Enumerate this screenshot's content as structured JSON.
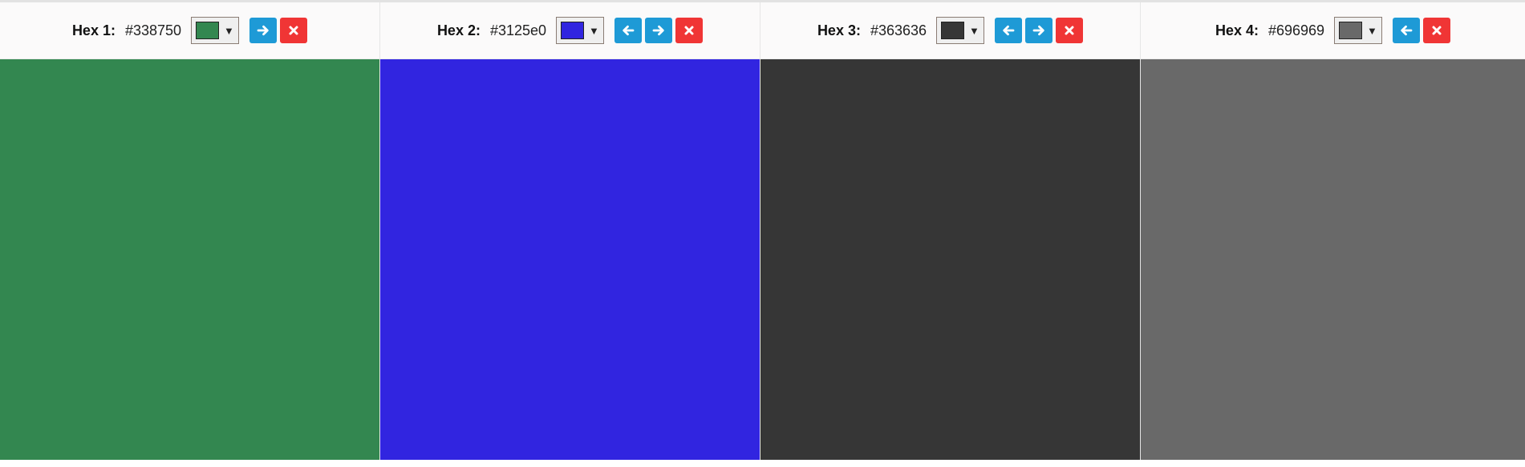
{
  "palette": {
    "colors": [
      {
        "label": "Hex 1:",
        "hex": "#338750",
        "color": "#338750",
        "has_left": false,
        "has_right": true
      },
      {
        "label": "Hex 2:",
        "hex": "#3125e0",
        "color": "#3125e0",
        "has_left": true,
        "has_right": true
      },
      {
        "label": "Hex 3:",
        "hex": "#363636",
        "color": "#363636",
        "has_left": true,
        "has_right": true
      },
      {
        "label": "Hex 4:",
        "hex": "#696969",
        "color": "#696969",
        "has_left": true,
        "has_right": false
      }
    ],
    "icons": {
      "move_left": "arrow-left-icon",
      "move_right": "arrow-right-icon",
      "remove": "close-icon",
      "dropdown": "chevron-down-icon"
    },
    "accent_colors": {
      "move_button": "#1e9ad6",
      "remove_button": "#f03535"
    }
  }
}
